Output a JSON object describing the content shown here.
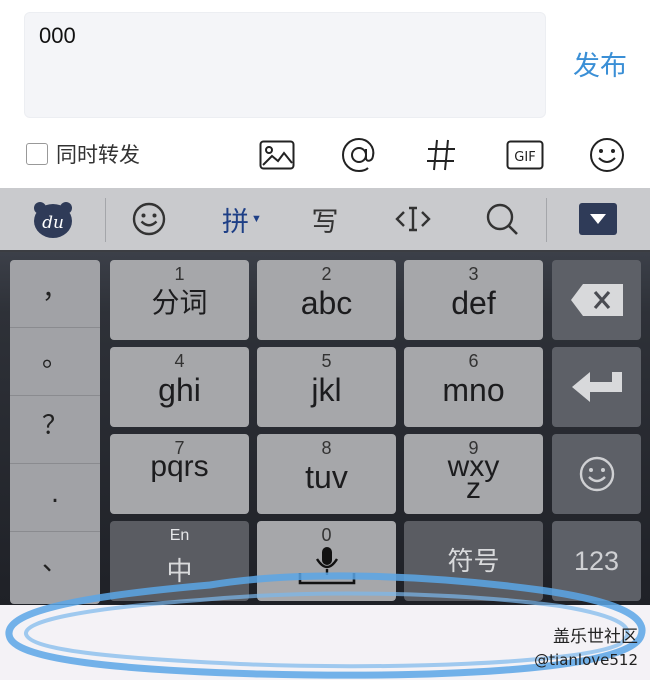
{
  "compose": {
    "text": "000",
    "publish_label": "发布",
    "forward_label": "同时转发",
    "tools": [
      "image-icon",
      "at-icon",
      "hashtag-icon",
      "gif-icon",
      "emoji-icon"
    ]
  },
  "keyboard": {
    "topbar": {
      "logo": "du",
      "pinyin_label": "拼",
      "handwrite_label": "写"
    },
    "punctuation": [
      "，",
      "。",
      "？",
      ".",
      "、"
    ],
    "keys": [
      {
        "num": "1",
        "label": "分词"
      },
      {
        "num": "2",
        "label": "abc"
      },
      {
        "num": "3",
        "label": "def"
      },
      {
        "num": "4",
        "label": "ghi"
      },
      {
        "num": "5",
        "label": "jkl"
      },
      {
        "num": "6",
        "label": "mno"
      },
      {
        "num": "7",
        "label": "pqrs"
      },
      {
        "num": "8",
        "label": "tuv"
      },
      {
        "num": "9",
        "label": "wxyz"
      }
    ],
    "lang_top": "En",
    "lang_bottom": "中",
    "space_num": "0",
    "symbol_label": "符号",
    "numeric_label": "123"
  },
  "watermark": {
    "line1": "盖乐世社区",
    "line2": "@tianlove512"
  },
  "colors": {
    "accent": "#3a8fd6",
    "keyboard_bg": "#2e3138",
    "key_bg": "#a6a7aa"
  }
}
